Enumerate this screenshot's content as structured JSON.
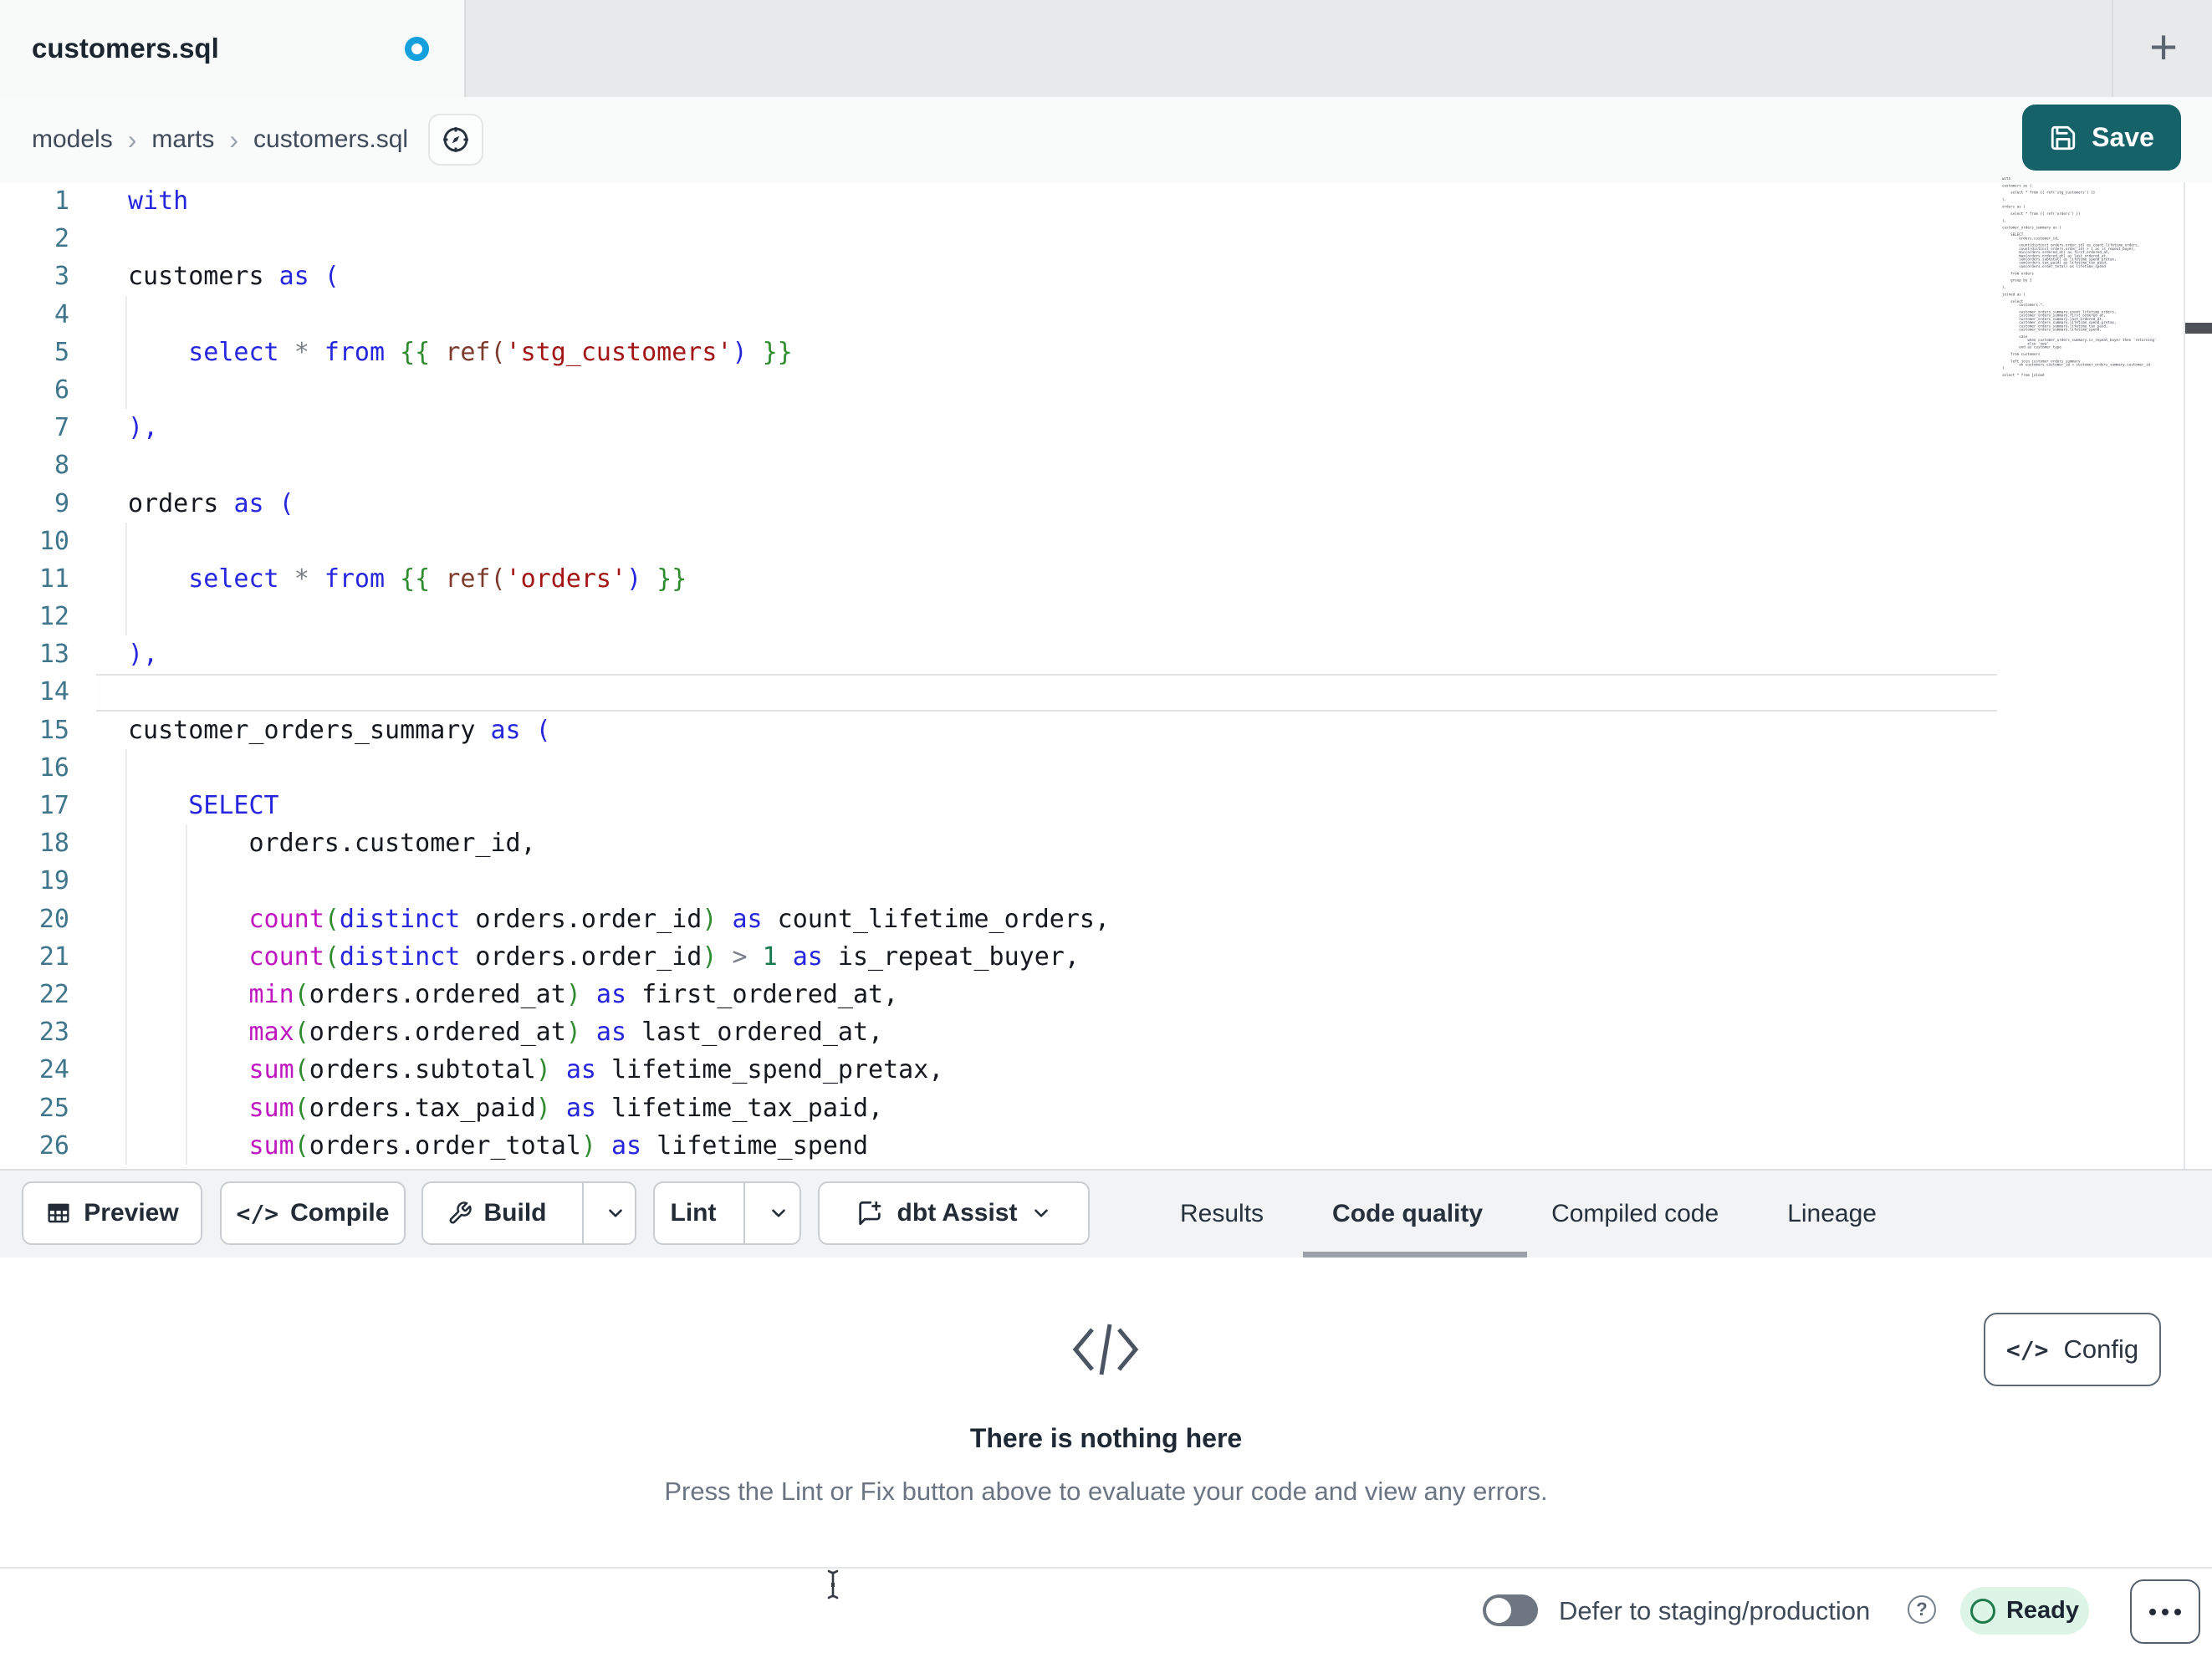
{
  "tab_bar": {
    "active_tab_label": "customers.sql",
    "new_tab_label": "+"
  },
  "breadcrumb": {
    "items": [
      "models",
      "marts",
      "customers.sql"
    ],
    "separator": "›"
  },
  "save_button": {
    "label": "Save"
  },
  "glyphs": {
    "code": "</>"
  },
  "toolbar": {
    "preview_label": "Preview",
    "compile_label": "Compile",
    "build_label": "Build",
    "lint_label": "Lint",
    "dbt_assist_label": "dbt Assist"
  },
  "panel_tabs": [
    {
      "label": "Results",
      "active": false
    },
    {
      "label": "Code quality",
      "active": true
    },
    {
      "label": "Compiled code",
      "active": false
    },
    {
      "label": "Lineage",
      "active": false
    }
  ],
  "empty_state": {
    "title": "There is nothing here",
    "subtitle": "Press the Lint or Fix button above to evaluate your code and view any errors.",
    "config_label": "Config"
  },
  "status_bar": {
    "defer_label": "Defer to staging/production",
    "ready_label": "Ready"
  },
  "colors": {
    "accent_teal": "#166269",
    "unsaved_dot_blue": "#14a0dc",
    "keyword": "#2626df",
    "function": "#bf17bf",
    "string": "#a31515",
    "jinja_brace": "#2e8b2e",
    "number": "#1a7a4f",
    "ref_call": "#7d3b2d",
    "operator": "#7a7f87",
    "plain_code": "#15181e",
    "line_number": "#3f768c",
    "ready_pill_bg": "#dcf5e7",
    "ready_ring": "#1f7a4c",
    "active_tab_underline": "#9aa1a9"
  },
  "editor": {
    "current_line": 14,
    "lines": [
      [
        [
          "with",
          "kw"
        ]
      ],
      [],
      [
        [
          "customers ",
          "plain"
        ],
        [
          "as",
          "kw"
        ],
        [
          " (",
          "kw"
        ]
      ],
      [],
      [
        [
          "    ",
          "plain"
        ],
        [
          "select",
          "kw"
        ],
        [
          " ",
          "plain"
        ],
        [
          "*",
          "op"
        ],
        [
          " ",
          "plain"
        ],
        [
          "from",
          "kw"
        ],
        [
          " ",
          "plain"
        ],
        [
          "{{",
          "jinja"
        ],
        [
          " ",
          "plain"
        ],
        [
          "ref(",
          "ref"
        ],
        [
          "'stg_customers'",
          "str"
        ],
        [
          ")",
          "kw"
        ],
        [
          " ",
          "plain"
        ],
        [
          "}}",
          "jinja"
        ]
      ],
      [],
      [
        [
          "),",
          "kw"
        ]
      ],
      [],
      [
        [
          "orders ",
          "plain"
        ],
        [
          "as",
          "kw"
        ],
        [
          " (",
          "kw"
        ]
      ],
      [],
      [
        [
          "    ",
          "plain"
        ],
        [
          "select",
          "kw"
        ],
        [
          " ",
          "plain"
        ],
        [
          "*",
          "op"
        ],
        [
          " ",
          "plain"
        ],
        [
          "from",
          "kw"
        ],
        [
          " ",
          "plain"
        ],
        [
          "{{",
          "jinja"
        ],
        [
          " ",
          "plain"
        ],
        [
          "ref(",
          "ref"
        ],
        [
          "'orders'",
          "str"
        ],
        [
          ")",
          "kw"
        ],
        [
          " ",
          "plain"
        ],
        [
          "}}",
          "jinja"
        ]
      ],
      [],
      [
        [
          "),",
          "kw"
        ]
      ],
      [],
      [
        [
          "customer_orders_summary ",
          "plain"
        ],
        [
          "as",
          "kw"
        ],
        [
          " (",
          "kw"
        ]
      ],
      [],
      [
        [
          "    ",
          "plain"
        ],
        [
          "SELECT",
          "kw"
        ]
      ],
      [
        [
          "        orders.customer_id,",
          "plain"
        ]
      ],
      [],
      [
        [
          "        ",
          "plain"
        ],
        [
          "count",
          "fn"
        ],
        [
          "(",
          "paren"
        ],
        [
          "distinct",
          "kw"
        ],
        [
          " orders.order_id",
          "plain"
        ],
        [
          ")",
          "paren"
        ],
        [
          " ",
          "plain"
        ],
        [
          "as",
          "kw"
        ],
        [
          " count_lifetime_orders,",
          "plain"
        ]
      ],
      [
        [
          "        ",
          "plain"
        ],
        [
          "count",
          "fn"
        ],
        [
          "(",
          "paren"
        ],
        [
          "distinct",
          "kw"
        ],
        [
          " orders.order_id",
          "plain"
        ],
        [
          ")",
          "paren"
        ],
        [
          " ",
          "plain"
        ],
        [
          ">",
          "op"
        ],
        [
          " ",
          "plain"
        ],
        [
          "1",
          "num"
        ],
        [
          " ",
          "plain"
        ],
        [
          "as",
          "kw"
        ],
        [
          " is_repeat_buyer,",
          "plain"
        ]
      ],
      [
        [
          "        ",
          "plain"
        ],
        [
          "min",
          "fn"
        ],
        [
          "(",
          "paren"
        ],
        [
          "orders.ordered_at",
          "plain"
        ],
        [
          ")",
          "paren"
        ],
        [
          " ",
          "plain"
        ],
        [
          "as",
          "kw"
        ],
        [
          " first_ordered_at,",
          "plain"
        ]
      ],
      [
        [
          "        ",
          "plain"
        ],
        [
          "max",
          "fn"
        ],
        [
          "(",
          "paren"
        ],
        [
          "orders.ordered_at",
          "plain"
        ],
        [
          ")",
          "paren"
        ],
        [
          " ",
          "plain"
        ],
        [
          "as",
          "kw"
        ],
        [
          " last_ordered_at,",
          "plain"
        ]
      ],
      [
        [
          "        ",
          "plain"
        ],
        [
          "sum",
          "fn"
        ],
        [
          "(",
          "paren"
        ],
        [
          "orders.subtotal",
          "plain"
        ],
        [
          ")",
          "paren"
        ],
        [
          " ",
          "plain"
        ],
        [
          "as",
          "kw"
        ],
        [
          " lifetime_spend_pretax,",
          "plain"
        ]
      ],
      [
        [
          "        ",
          "plain"
        ],
        [
          "sum",
          "fn"
        ],
        [
          "(",
          "paren"
        ],
        [
          "orders.tax_paid",
          "plain"
        ],
        [
          ")",
          "paren"
        ],
        [
          " ",
          "plain"
        ],
        [
          "as",
          "kw"
        ],
        [
          " lifetime_tax_paid,",
          "plain"
        ]
      ],
      [
        [
          "        ",
          "plain"
        ],
        [
          "sum",
          "fn"
        ],
        [
          "(",
          "paren"
        ],
        [
          "orders.order_total",
          "plain"
        ],
        [
          ")",
          "paren"
        ],
        [
          " ",
          "plain"
        ],
        [
          "as",
          "kw"
        ],
        [
          " lifetime_spend",
          "plain"
        ]
      ]
    ],
    "minimap_text": "with\n\ncustomers as (\n\n    select * from {{ ref('stg_customers') }}\n\n),\n\norders as (\n\n    select * from {{ ref('orders') }}\n\n),\n\ncustomer_orders_summary as (\n\n    SELECT\n        orders.customer_id,\n\n        count(distinct orders.order_id) as count_lifetime_orders,\n        count(distinct orders.order_id) > 1 as is_repeat_buyer,\n        min(orders.ordered_at) as first_ordered_at,\n        max(orders.ordered_at) as last_ordered_at,\n        sum(orders.subtotal) as lifetime_spend_pretax,\n        sum(orders.tax_paid) as lifetime_tax_paid,\n        sum(orders.order_total) as lifetime_spend\n\n    from orders\n\n    group by 1\n\n),\n\njoined as (\n\n    select\n        customers.*,\n\n        customer_orders_summary.count_lifetime_orders,\n        customer_orders_summary.first_ordered_at,\n        customer_orders_summary.last_ordered_at,\n        customer_orders_summary.lifetime_spend_pretax,\n        customer_orders_summary.lifetime_tax_paid,\n        customer_orders_summary.lifetime_spend,\n\n        case\n            when customer_orders_summary.is_repeat_buyer then 'returning'\n            else 'new'\n        end as customer_type\n\n    from customers\n\n    left join customer_orders_summary\n        on customers.customer_id = customer_orders_summary.customer_id\n)\n\nselect * from joined"
  }
}
